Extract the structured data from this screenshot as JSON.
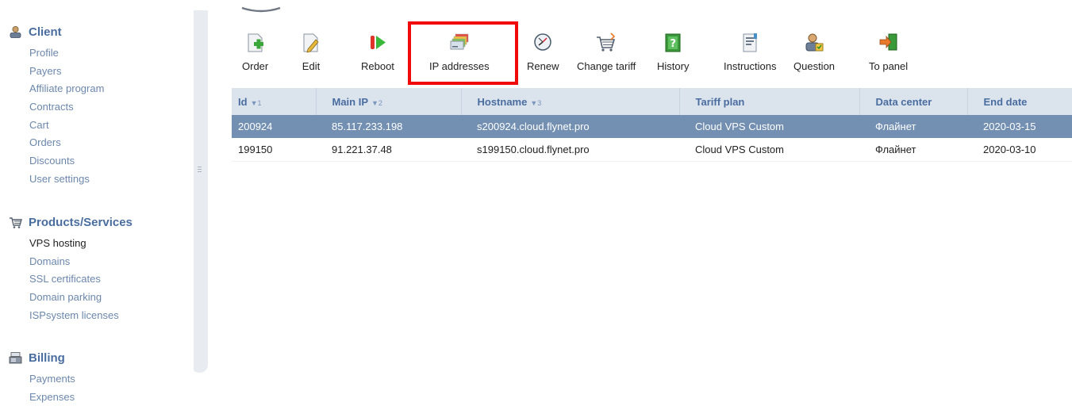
{
  "sidebar": {
    "sections": [
      {
        "title": "Client",
        "icon": "user-icon",
        "items": [
          "Profile",
          "Payers",
          "Affiliate program",
          "Contracts",
          "Cart",
          "Orders",
          "Discounts",
          "User settings"
        ]
      },
      {
        "title": "Products/Services",
        "icon": "cart-icon",
        "items": [
          "VPS hosting",
          "Domains",
          "SSL certificates",
          "Domain parking",
          "ISPsystem licenses"
        ],
        "active": "VPS hosting"
      },
      {
        "title": "Billing",
        "icon": "cash-register-icon",
        "items": [
          "Payments",
          "Expenses"
        ]
      }
    ]
  },
  "toolbar": {
    "order": "Order",
    "edit": "Edit",
    "reboot": "Reboot",
    "ip_addresses": "IP addresses",
    "renew": "Renew",
    "change_tariff": "Change tariff",
    "history": "History",
    "instructions": "Instructions",
    "question": "Question",
    "to_panel": "To panel"
  },
  "table": {
    "columns": [
      {
        "label": "Id",
        "sort": "▼1"
      },
      {
        "label": "Main IP",
        "sort": "▼2"
      },
      {
        "label": "Hostname",
        "sort": "▼3"
      },
      {
        "label": "Tariff plan",
        "sort": ""
      },
      {
        "label": "Data center",
        "sort": ""
      },
      {
        "label": "End date",
        "sort": ""
      }
    ],
    "rows": [
      {
        "id": "200924",
        "ip": "85.117.233.198",
        "host": "s200924.cloud.flynet.pro",
        "tariff": "Cloud VPS Custom",
        "dc": "Флайнет",
        "end": "2020-03-15"
      },
      {
        "id": "199150",
        "ip": "91.221.37.48",
        "host": "s199150.cloud.flynet.pro",
        "tariff": "Cloud VPS Custom",
        "dc": "Флайнет",
        "end": "2020-03-10"
      }
    ]
  },
  "colors": {
    "accent": "#4a6da0",
    "selected_row": "#7390b3",
    "header_bg": "#dbe3ed",
    "highlight_border": "#f10a0a"
  }
}
